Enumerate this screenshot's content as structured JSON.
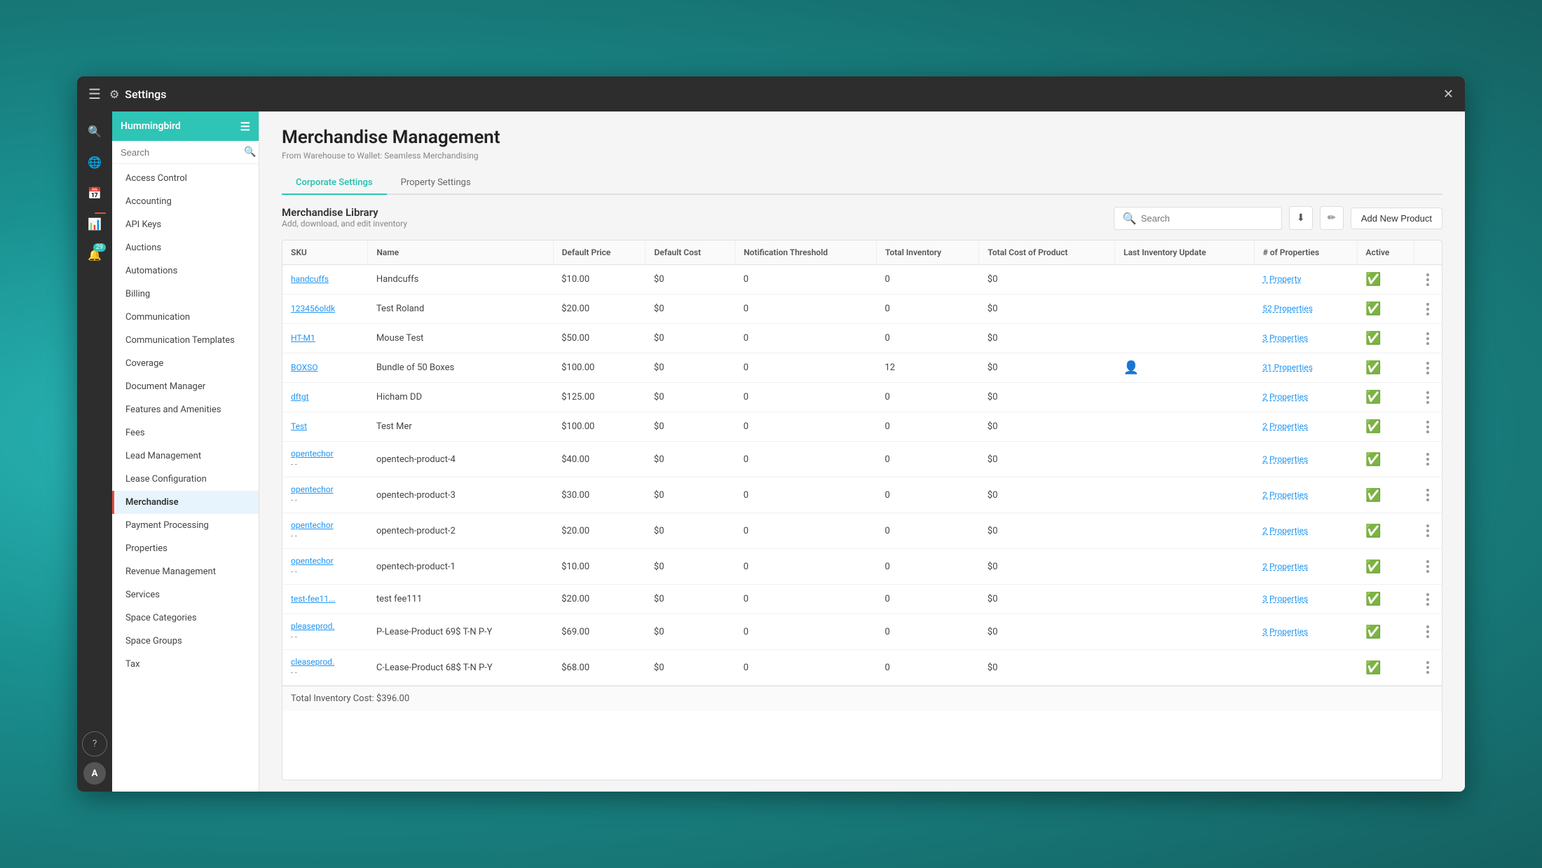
{
  "window": {
    "title": "Settings",
    "close_label": "✕"
  },
  "sidebar_icons": [
    {
      "name": "search-icon",
      "symbol": "🔍",
      "active": true
    },
    {
      "name": "globe-icon",
      "symbol": "🌐"
    },
    {
      "name": "calendar-icon",
      "symbol": "📅"
    },
    {
      "name": "activity-icon",
      "symbol": "📊",
      "badge": "",
      "badge_type": "red"
    },
    {
      "name": "notification-icon",
      "symbol": "🔔",
      "badge": "29",
      "badge_type": "teal"
    }
  ],
  "sidebar_bottom": [
    {
      "name": "help-icon",
      "symbol": "?"
    },
    {
      "name": "avatar",
      "label": "A"
    }
  ],
  "nav": {
    "header": "Hummingbird",
    "search_placeholder": "Search",
    "items": [
      {
        "label": "Access Control",
        "active": false
      },
      {
        "label": "Accounting",
        "active": false
      },
      {
        "label": "API Keys",
        "active": false
      },
      {
        "label": "Auctions",
        "active": false
      },
      {
        "label": "Automations",
        "active": false
      },
      {
        "label": "Billing",
        "active": false
      },
      {
        "label": "Communication",
        "active": false
      },
      {
        "label": "Communication Templates",
        "active": false
      },
      {
        "label": "Coverage",
        "active": false
      },
      {
        "label": "Document Manager",
        "active": false
      },
      {
        "label": "Features and Amenities",
        "active": false
      },
      {
        "label": "Fees",
        "active": false
      },
      {
        "label": "Lead Management",
        "active": false
      },
      {
        "label": "Lease Configuration",
        "active": false
      },
      {
        "label": "Merchandise",
        "active": true
      },
      {
        "label": "Payment Processing",
        "active": false
      },
      {
        "label": "Properties",
        "active": false
      },
      {
        "label": "Revenue Management",
        "active": false
      },
      {
        "label": "Services",
        "active": false
      },
      {
        "label": "Space Categories",
        "active": false
      },
      {
        "label": "Space Groups",
        "active": false
      },
      {
        "label": "Tax",
        "active": false
      }
    ]
  },
  "page": {
    "title": "Merchandise Management",
    "subtitle": "From Warehouse to Wallet: Seamless Merchandising",
    "tabs": [
      {
        "label": "Corporate Settings",
        "active": true
      },
      {
        "label": "Property Settings",
        "active": false
      }
    ]
  },
  "merchandise_library": {
    "title": "Merchandise Library",
    "description": "Add, download, and edit inventory",
    "search_placeholder": "Search",
    "add_button": "Add New Product",
    "total_inventory_cost": "Total Inventory Cost: $396.00",
    "columns": [
      {
        "key": "sku",
        "label": "SKU"
      },
      {
        "key": "name",
        "label": "Name"
      },
      {
        "key": "default_price",
        "label": "Default Price"
      },
      {
        "key": "default_cost",
        "label": "Default Cost"
      },
      {
        "key": "notification_threshold",
        "label": "Notification Threshold"
      },
      {
        "key": "total_inventory",
        "label": "Total Inventory"
      },
      {
        "key": "total_cost_product",
        "label": "Total Cost of Product"
      },
      {
        "key": "last_inventory_update",
        "label": "Last Inventory Update"
      },
      {
        "key": "num_properties",
        "label": "# of Properties"
      },
      {
        "key": "active",
        "label": "Active"
      }
    ],
    "rows": [
      {
        "sku": "handcuffs",
        "sku_sub": "",
        "name": "Handcuffs",
        "default_price": "$10.00",
        "default_cost": "$0",
        "notification_threshold": "0",
        "total_inventory": "0",
        "total_cost_product": "$0",
        "last_inventory_update": "",
        "num_properties": "1 Property",
        "active": true
      },
      {
        "sku": "123456oldk",
        "sku_sub": "",
        "name": "Test Roland",
        "default_price": "$20.00",
        "default_cost": "$0",
        "notification_threshold": "0",
        "total_inventory": "0",
        "total_cost_product": "$0",
        "last_inventory_update": "",
        "num_properties": "52 Properties",
        "active": true
      },
      {
        "sku": "HT-M1",
        "sku_sub": "",
        "name": "Mouse Test",
        "default_price": "$50.00",
        "default_cost": "$0",
        "notification_threshold": "0",
        "total_inventory": "0",
        "total_cost_product": "$0",
        "last_inventory_update": "",
        "num_properties": "3 Properties",
        "active": true
      },
      {
        "sku": "BOXSO",
        "sku_sub": "",
        "name": "Bundle of 50 Boxes",
        "default_price": "$100.00",
        "default_cost": "$0",
        "notification_threshold": "0",
        "total_inventory": "12",
        "total_cost_product": "$0",
        "last_inventory_update": "👤",
        "num_properties": "31 Properties",
        "active": true
      },
      {
        "sku": "dftgt",
        "sku_sub": "",
        "name": "Hicham DD",
        "default_price": "$125.00",
        "default_cost": "$0",
        "notification_threshold": "0",
        "total_inventory": "0",
        "total_cost_product": "$0",
        "last_inventory_update": "",
        "num_properties": "2 Properties",
        "active": true
      },
      {
        "sku": "Test",
        "sku_sub": "",
        "name": "Test Mer",
        "default_price": "$100.00",
        "default_cost": "$0",
        "notification_threshold": "0",
        "total_inventory": "0",
        "total_cost_product": "$0",
        "last_inventory_update": "",
        "num_properties": "2 Properties",
        "active": true
      },
      {
        "sku": "opentechor",
        "sku_sub": "- -",
        "name": "opentech-product-4",
        "default_price": "$40.00",
        "default_cost": "$0",
        "notification_threshold": "0",
        "total_inventory": "0",
        "total_cost_product": "$0",
        "last_inventory_update": "",
        "num_properties": "2 Properties",
        "active": true
      },
      {
        "sku": "opentechor",
        "sku_sub": "- -",
        "name": "opentech-product-3",
        "default_price": "$30.00",
        "default_cost": "$0",
        "notification_threshold": "0",
        "total_inventory": "0",
        "total_cost_product": "$0",
        "last_inventory_update": "",
        "num_properties": "2 Properties",
        "active": true
      },
      {
        "sku": "opentechor",
        "sku_sub": "- -",
        "name": "opentech-product-2",
        "default_price": "$20.00",
        "default_cost": "$0",
        "notification_threshold": "0",
        "total_inventory": "0",
        "total_cost_product": "$0",
        "last_inventory_update": "",
        "num_properties": "2 Properties",
        "active": true
      },
      {
        "sku": "opentechor",
        "sku_sub": "- -",
        "name": "opentech-product-1",
        "default_price": "$10.00",
        "default_cost": "$0",
        "notification_threshold": "0",
        "total_inventory": "0",
        "total_cost_product": "$0",
        "last_inventory_update": "",
        "num_properties": "2 Properties",
        "active": true
      },
      {
        "sku": "test-fee11...",
        "sku_sub": "",
        "name": "test fee111",
        "default_price": "$20.00",
        "default_cost": "$0",
        "notification_threshold": "0",
        "total_inventory": "0",
        "total_cost_product": "$0",
        "last_inventory_update": "",
        "num_properties": "3 Properties",
        "active": true
      },
      {
        "sku": "pleaseprod.",
        "sku_sub": "- -",
        "name": "P-Lease-Product 69$ T-N P-Y",
        "default_price": "$69.00",
        "default_cost": "$0",
        "notification_threshold": "0",
        "total_inventory": "0",
        "total_cost_product": "$0",
        "last_inventory_update": "",
        "num_properties": "3 Properties",
        "active": true
      },
      {
        "sku": "cleaseprod.",
        "sku_sub": "- -",
        "name": "C-Lease-Product 68$ T-N P-Y",
        "default_price": "$68.00",
        "default_cost": "$0",
        "notification_threshold": "0",
        "total_inventory": "0",
        "total_cost_product": "$0",
        "last_inventory_update": "",
        "num_properties": "",
        "active": true
      }
    ]
  }
}
